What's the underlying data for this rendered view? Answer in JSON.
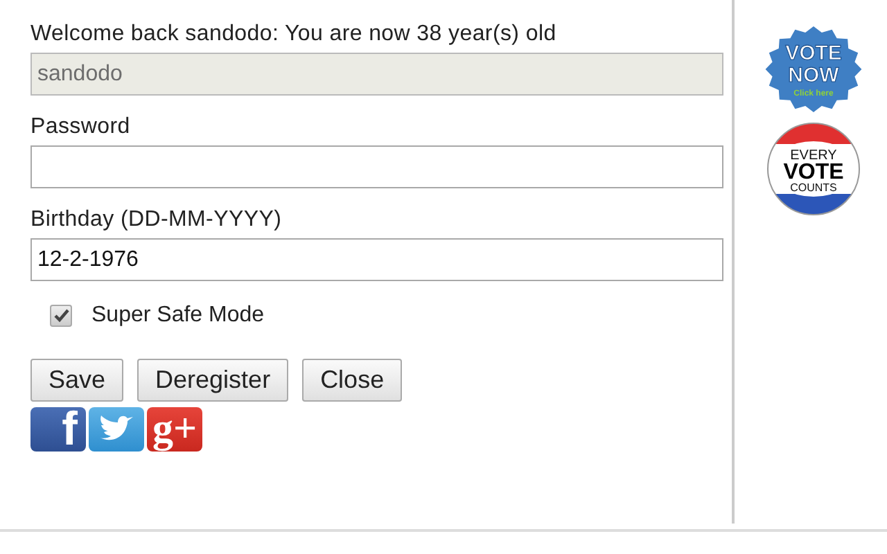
{
  "fields": [
    {
      "label": "Welcome back sandodo: You are now 38 year(s) old",
      "value": "sandodo",
      "disabled": true
    },
    {
      "label": "Password",
      "disabled": false
    },
    {
      "label": "Birthday (DD-MM-YYYY)",
      "value": "12-2-1976",
      "disabled": false
    }
  ],
  "super_safe_mode": {
    "label": "Super Safe Mode",
    "checked": true
  },
  "buttons": [
    "Save",
    "Deregister",
    "Close"
  ],
  "social": [
    {
      "kind": "facebook",
      "glyph": "f"
    },
    {
      "kind": "twitter"
    },
    {
      "kind": "googleplus",
      "glyph": "g+"
    }
  ],
  "badges": [
    {
      "kind": "vote_now",
      "lines": [
        "VOTE",
        "NOW"
      ],
      "caption": "Click here"
    },
    {
      "kind": "every_vote",
      "lines": [
        "EVERY",
        "VOTE",
        "COUNTS"
      ]
    }
  ]
}
